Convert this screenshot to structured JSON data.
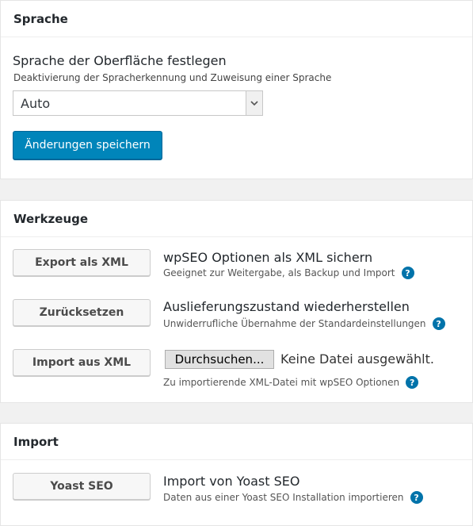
{
  "sprache": {
    "title": "Sprache",
    "label": "Sprache der Oberfläche festlegen",
    "description": "Deaktivierung der Spracherkennung und Zuweisung einer Sprache",
    "select_value": "Auto",
    "save_label": "Änderungen speichern"
  },
  "werkzeuge": {
    "title": "Werkzeuge",
    "tools": [
      {
        "button": "Export als XML",
        "title": "wpSEO Optionen als XML sichern",
        "desc": "Geeignet zur Weitergabe, als Backup und Import"
      },
      {
        "button": "Zurücksetzen",
        "title": "Auslieferungszustand wiederherstellen",
        "desc": "Unwiderrufliche Übernahme der Standardeinstellungen"
      },
      {
        "button": "Import aus XML",
        "browse": "Durchsuchen...",
        "file_status": "Keine Datei ausgewählt.",
        "desc": "Zu importierende XML-Datei mit wpSEO Optionen"
      }
    ]
  },
  "import": {
    "title": "Import",
    "button": "Yoast SEO",
    "item_title": "Import von Yoast SEO",
    "desc": "Daten aus einer Yoast SEO Installation importieren"
  },
  "help_glyph": "?",
  "icons": {
    "help": "help-icon",
    "dropdown": "chevron-down-icon"
  },
  "colors": {
    "primary": "#0085ba",
    "help": "#0073aa",
    "background": "#f1f1f1"
  }
}
